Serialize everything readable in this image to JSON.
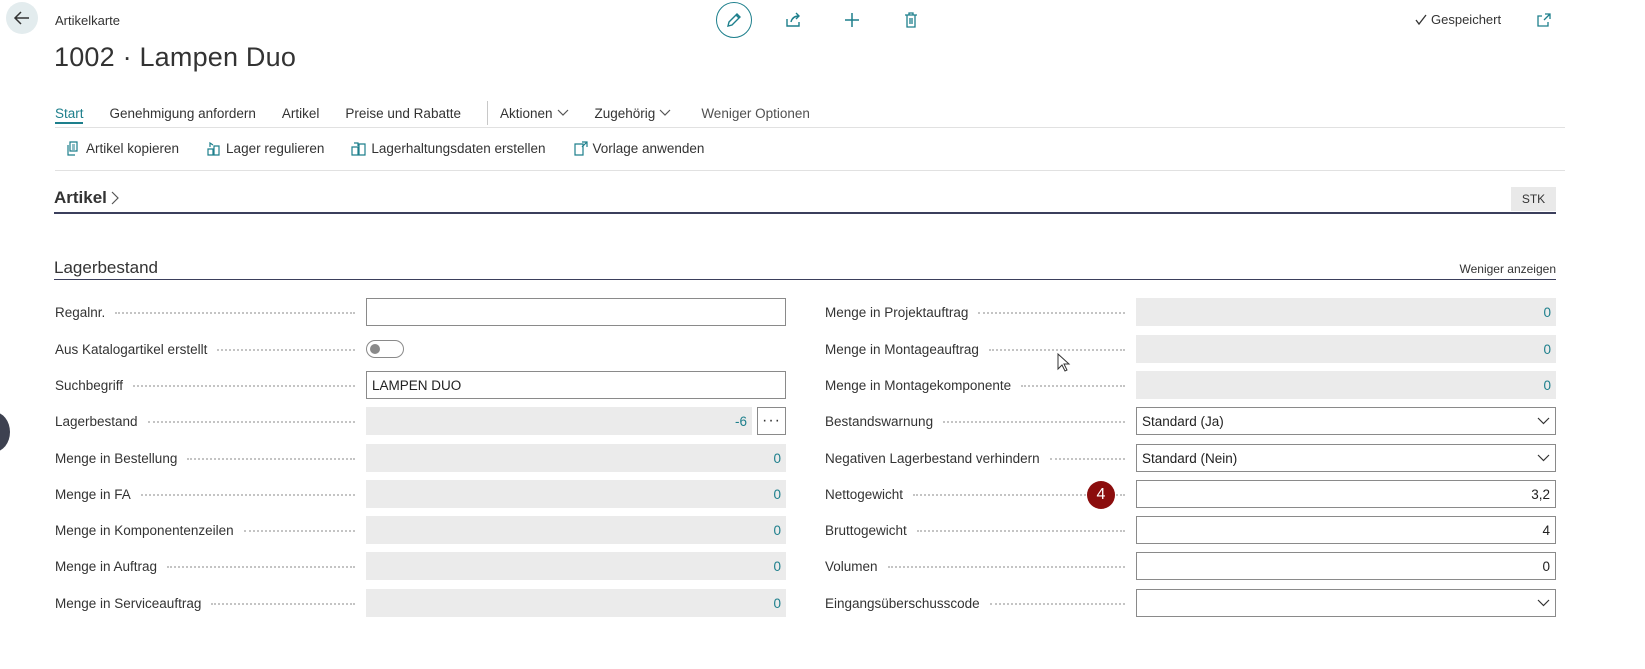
{
  "header": {
    "breadcrumb": "Artikelkarte",
    "title": "1002 · Lampen Duo",
    "saved_status": "Gespeichert"
  },
  "actionbar": {
    "tabs": [
      {
        "label": "Start"
      },
      {
        "label": "Genehmigung anfordern"
      },
      {
        "label": "Artikel"
      },
      {
        "label": "Preise und Rabatte"
      }
    ],
    "aktionen": "Aktionen",
    "zugehoerig": "Zugehörig",
    "fewer": "Weniger Optionen"
  },
  "commands": [
    {
      "label": "Artikel kopieren",
      "icon": "copy-icon"
    },
    {
      "label": "Lager regulieren",
      "icon": "adjust-inventory-icon"
    },
    {
      "label": "Lagerhaltungsdaten erstellen",
      "icon": "create-sku-icon"
    },
    {
      "label": "Vorlage anwenden",
      "icon": "apply-template-icon"
    }
  ],
  "section_artikel": {
    "title": "Artikel",
    "unit_badge": "STK"
  },
  "section_lager": {
    "title": "Lagerbestand",
    "show_less": "Weniger anzeigen",
    "left": [
      {
        "label": "Regalnr.",
        "value": ""
      },
      {
        "label": "Aus Katalogartikel erstellt",
        "value": false
      },
      {
        "label": "Suchbegriff",
        "value": "LAMPEN DUO"
      },
      {
        "label": "Lagerbestand",
        "value": "-6"
      },
      {
        "label": "Menge in Bestellung",
        "value": "0"
      },
      {
        "label": "Menge in FA",
        "value": "0"
      },
      {
        "label": "Menge in Komponentenzeilen",
        "value": "0"
      },
      {
        "label": "Menge in Auftrag",
        "value": "0"
      },
      {
        "label": "Menge in Serviceauftrag",
        "value": "0"
      }
    ],
    "right": [
      {
        "label": "Menge in Projektauftrag",
        "value": "0"
      },
      {
        "label": "Menge in Montageauftrag",
        "value": "0"
      },
      {
        "label": "Menge in Montagekomponente",
        "value": "0"
      },
      {
        "label": "Bestandswarnung",
        "value": "Standard (Ja)"
      },
      {
        "label": "Negativen Lagerbestand verhindern",
        "value": "Standard (Nein)"
      },
      {
        "label": "Nettogewicht",
        "value": "3,2"
      },
      {
        "label": "Bruttogewicht",
        "value": "4"
      },
      {
        "label": "Volumen",
        "value": "0"
      },
      {
        "label": "Eingangsüberschusscode",
        "value": ""
      }
    ]
  },
  "step_badge": "4",
  "colors": {
    "accent": "#1d7f8c",
    "badge": "#8b0d0d",
    "section_line": "#3b3f5c",
    "readonly_bg": "#ebebeb"
  }
}
